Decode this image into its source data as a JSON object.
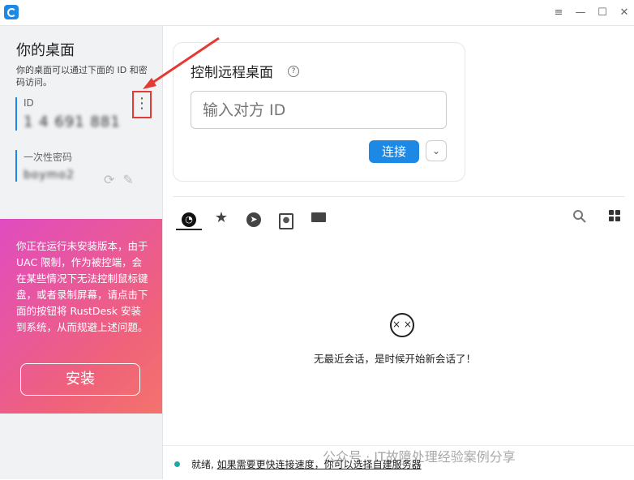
{
  "window": {
    "buttons": [
      "≡",
      "—",
      "☐",
      "✕"
    ]
  },
  "sidebar": {
    "title": "你的桌面",
    "description": "你的桌面可以通过下面的 ID 和密码访问。",
    "id_label": "ID",
    "id_value": "1 4 691 881",
    "password_label": "一次性密码",
    "password_value": "boymo2"
  },
  "warning": {
    "text": "你正在运行未安装版本，由于 UAC 限制，作为被控端，会在某些情况下无法控制鼠标键盘，或者录制屏幕，请点击下面的按钮将 RustDesk 安装到系统，从而规避上述问题。",
    "install_label": "安装"
  },
  "connect": {
    "title": "控制远程桌面",
    "placeholder": "输入对方 ID",
    "connect_label": "连接"
  },
  "empty": {
    "message": "无最近会话，是时候开始新会话了！"
  },
  "status": {
    "ready": "就绪,",
    "link": "如果需要更快连接速度，你可以选择自建服务器"
  },
  "watermark": "公众号 · IT故障处理经验案例分享",
  "colors": {
    "accent": "#1e88e5",
    "highlight": "#e53935"
  }
}
